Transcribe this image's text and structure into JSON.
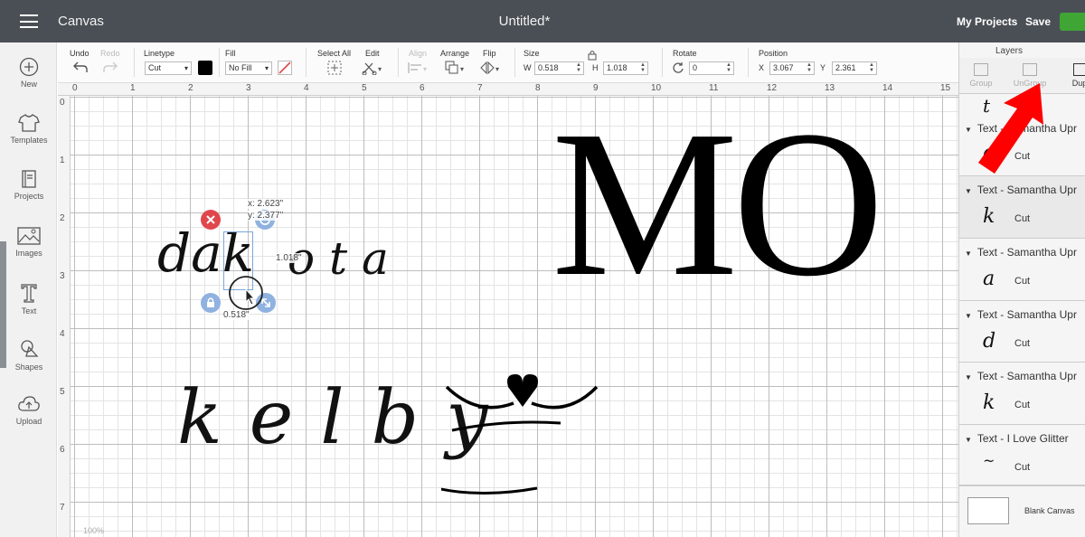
{
  "topbar": {
    "app_title": "Canvas",
    "doc_title": "Untitled*",
    "my_projects": "My Projects",
    "save": "Save"
  },
  "sidebar": {
    "items": [
      {
        "label": "New",
        "icon": "plus-circle-icon"
      },
      {
        "label": "Templates",
        "icon": "shirt-icon"
      },
      {
        "label": "Projects",
        "icon": "book-icon"
      },
      {
        "label": "Images",
        "icon": "image-icon"
      },
      {
        "label": "Text",
        "icon": "text-icon"
      },
      {
        "label": "Shapes",
        "icon": "shapes-icon"
      },
      {
        "label": "Upload",
        "icon": "cloud-upload-icon"
      }
    ]
  },
  "toolbar": {
    "undo": "Undo",
    "redo": "Redo",
    "linetype_label": "Linetype",
    "linetype_value": "Cut",
    "fill_label": "Fill",
    "fill_value": "No Fill",
    "select_all": "Select All",
    "edit": "Edit",
    "align": "Align",
    "arrange": "Arrange",
    "flip": "Flip",
    "size_label": "Size",
    "w_label": "W",
    "w_value": "0.518",
    "h_label": "H",
    "h_value": "1.018",
    "rotate_label": "Rotate",
    "rotate_value": "0",
    "position_label": "Position",
    "x_label": "X",
    "x_value": "3.067",
    "y_label": "Y",
    "y_value": "2.361",
    "linetype_color": "#000000"
  },
  "rulers": {
    "top": [
      "0",
      "1",
      "2",
      "3",
      "4",
      "5",
      "6",
      "7",
      "8",
      "9",
      "10",
      "11",
      "12",
      "13",
      "14",
      "15"
    ],
    "left": [
      "0",
      "1",
      "2",
      "3",
      "4",
      "5",
      "6",
      "7"
    ]
  },
  "canvas": {
    "text_dakota_left": "dak",
    "text_dakota_right": "o t a",
    "text_kelby": "k e l b y",
    "text_mo": "MO",
    "tooltip_x": "x: 2.623\"",
    "tooltip_y": "y: 2.377\"",
    "height_tip": "1.018\"",
    "width_tip": "0.518\"",
    "zoom": "100%"
  },
  "layers": {
    "title": "Layers",
    "group": "Group",
    "ungroup": "UnGroup",
    "duplicate": "Dupl",
    "items": [
      {
        "title": "Text - Samantha Upr",
        "glyph": "o",
        "cut": "Cut"
      },
      {
        "title": "Text - Samantha Upr",
        "glyph": "k",
        "cut": "Cut"
      },
      {
        "title": "Text - Samantha Upr",
        "glyph": "a",
        "cut": "Cut"
      },
      {
        "title": "Text - Samantha Upr",
        "glyph": "d",
        "cut": "Cut"
      },
      {
        "title": "Text - Samantha Upr",
        "glyph": "k",
        "cut": "Cut"
      },
      {
        "title": "Text - I Love Glitter",
        "glyph": "~",
        "cut": "Cut"
      }
    ],
    "blank_canvas": "Blank Canvas"
  },
  "colors": {
    "topbar": "#4a4f55",
    "accent_green": "#3fa535",
    "delete_red": "#e0474c",
    "handle_blue": "#8fb2e0",
    "arrow_red": "#ff0000"
  }
}
